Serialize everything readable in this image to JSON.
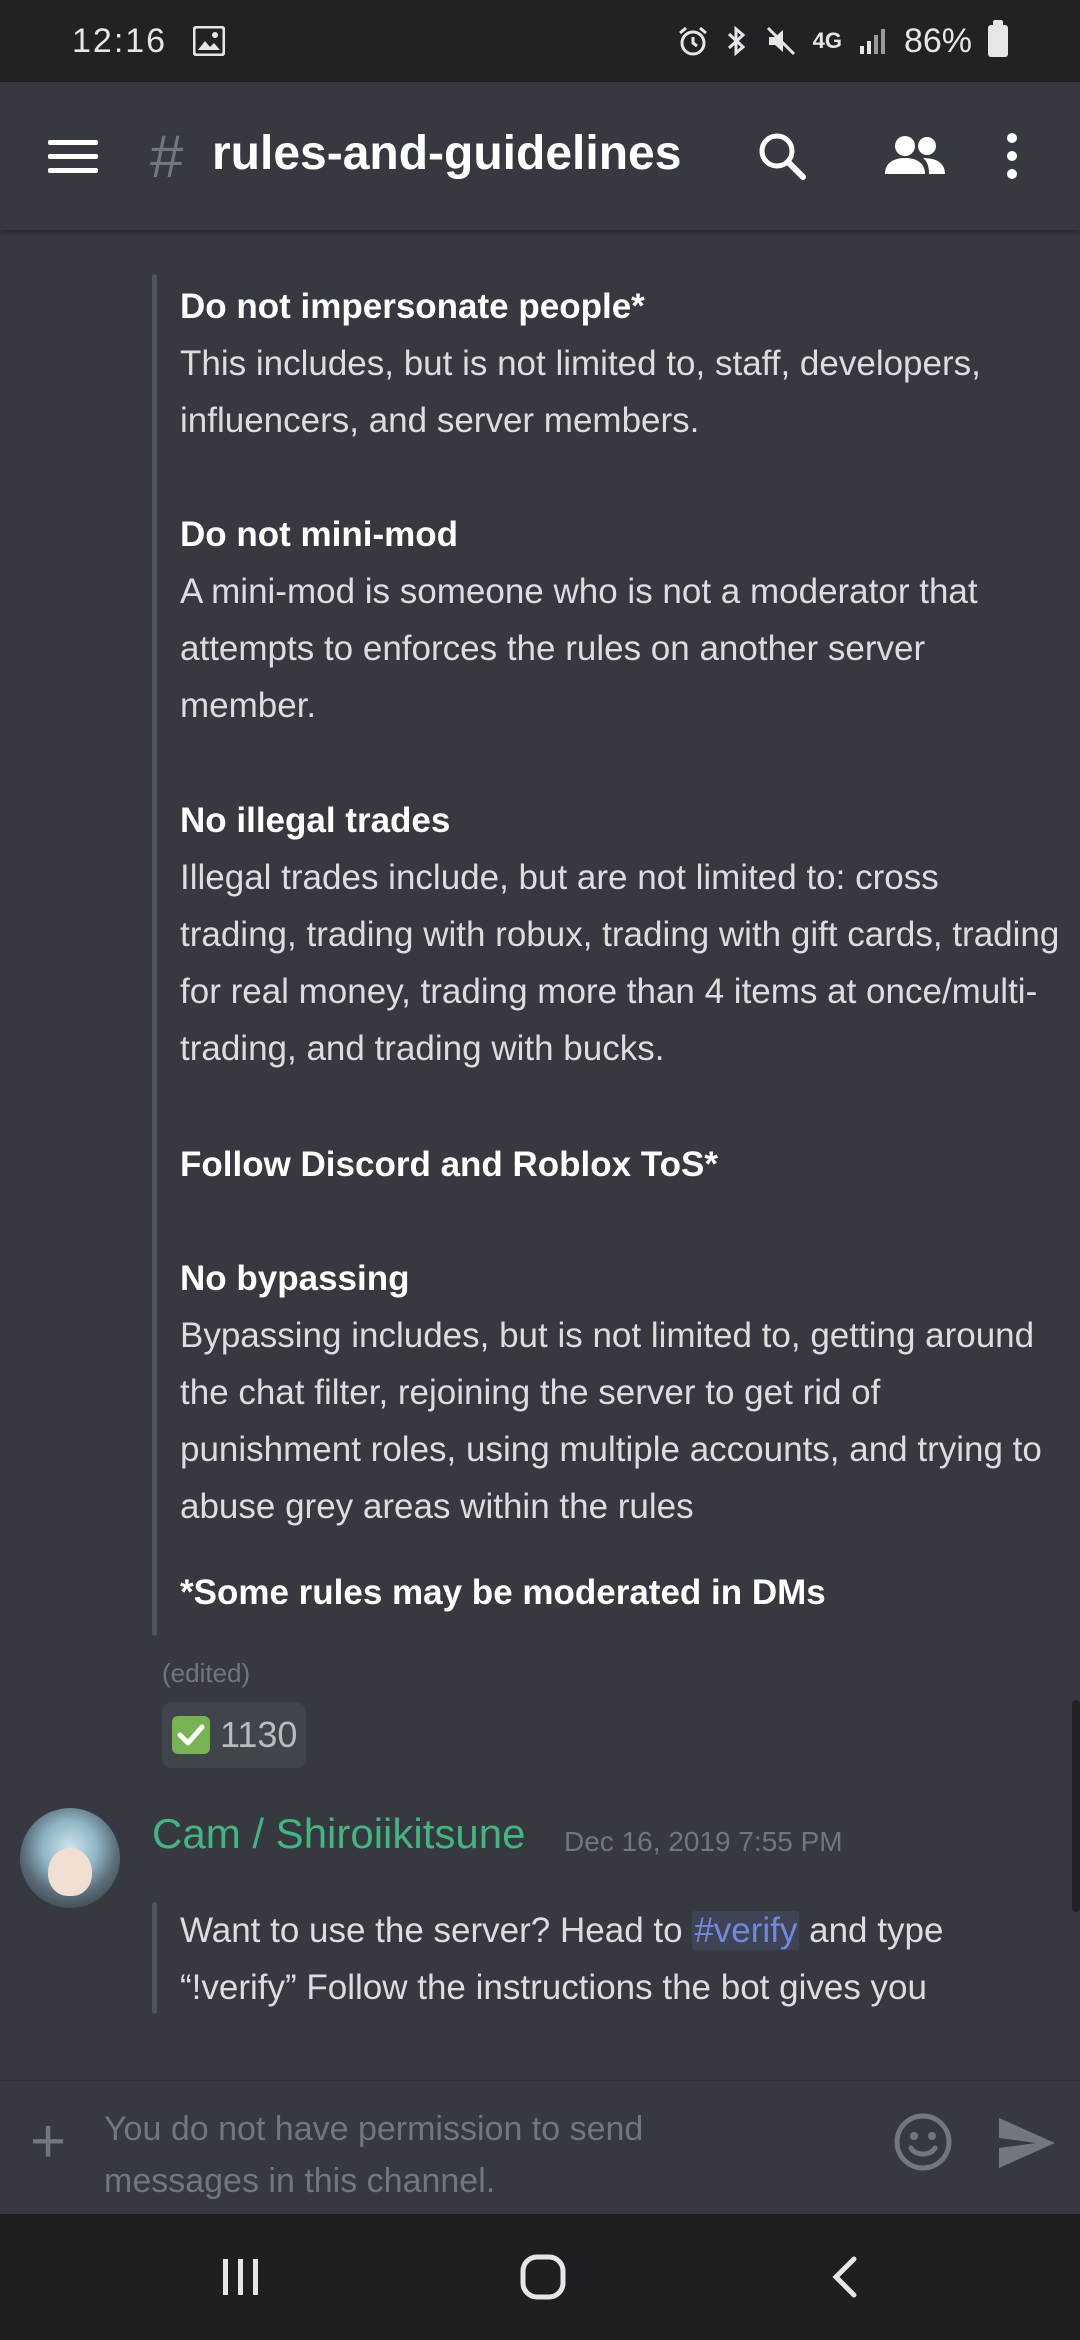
{
  "status_bar": {
    "time": "12:16",
    "network": "4G",
    "battery": "86%"
  },
  "header": {
    "hash": "#",
    "channel": "rules-and-guidelines"
  },
  "rules": [
    {
      "title": "Do not impersonate people*",
      "body": "This includes, but is not limited to, staff, developers, influencers, and server members."
    },
    {
      "title": "Do not mini-mod",
      "body": "A mini-mod is someone who is not a moderator that attempts to enforces the rules on another server member."
    },
    {
      "title": "No illegal trades",
      "body": "Illegal trades include, but are not limited to: cross trading, trading with robux, trading with gift cards, trading for real money, trading more than 4 items at once/multi-trading, and trading with bucks."
    },
    {
      "title": "Follow Discord and Roblox ToS*",
      "body": ""
    },
    {
      "title": "No bypassing",
      "body": "Bypassing includes, but is not limited to, getting around the chat filter, rejoining the server to get rid of punishment roles, using multiple accounts, and trying to abuse grey areas within the rules"
    },
    {
      "title": "*Some rules may be moderated in DMs",
      "body": ""
    }
  ],
  "edited_label": "(edited)",
  "reaction": {
    "emoji": "white-check-mark",
    "count": "1130"
  },
  "message": {
    "author": "Cam / Shiroiikitsune",
    "timestamp": "Dec 16, 2019 7:55 PM",
    "text_before": "Want to use the server? Head to ",
    "mention": "#verify",
    "text_after": " and type “!verify” Follow the instructions the bot gives you"
  },
  "input": {
    "placeholder": "You do not have permission to send messages in this channel."
  },
  "colors": {
    "background": "#36393f",
    "author": "#43b581",
    "mention": "#7289da"
  }
}
